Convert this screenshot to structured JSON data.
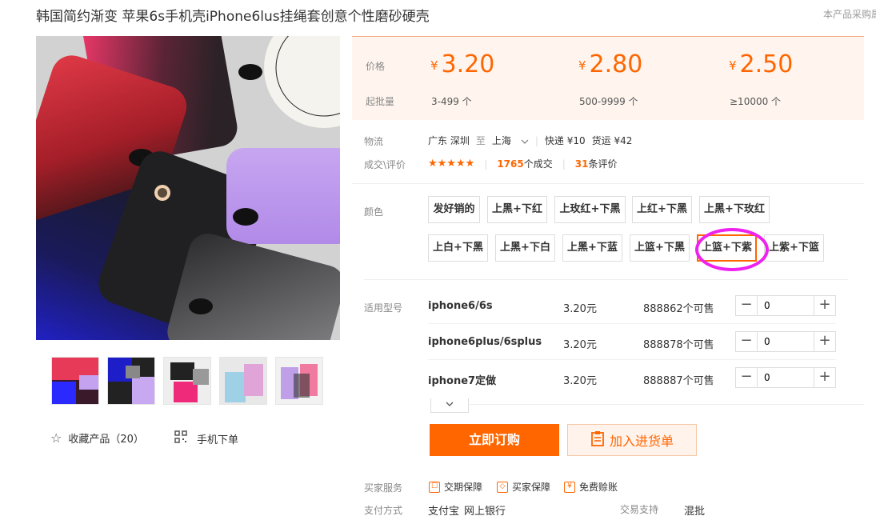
{
  "product": {
    "title": "韩国简约渐变 苹果6s手机壳iPhone6lus挂绳套创意个性磨砂硬壳",
    "notice": "本产品采购属"
  },
  "gallery": {
    "thumbnails": [
      "thumb-1",
      "thumb-2",
      "thumb-3",
      "thumb-4",
      "thumb-5"
    ],
    "favorite_label": "收藏产品（20）",
    "mobile_label": "手机下单"
  },
  "pricing": {
    "price_label": "价格",
    "min_qty_label": "起批量",
    "currency": "¥",
    "tiers": [
      {
        "price": "3.20",
        "qty": "3-499 个"
      },
      {
        "price": "2.80",
        "qty": "500-9999 个"
      },
      {
        "price": "2.50",
        "qty": "≥10000 个"
      }
    ]
  },
  "logistics": {
    "label": "物流",
    "from": "广东 深圳",
    "to_word": "至",
    "to": "上海",
    "express": "快递 ¥10",
    "freight": "货运 ¥42"
  },
  "deals": {
    "label": "成交\\评价",
    "stars": "★★★★★",
    "count": "1765",
    "count_suffix": "个成交",
    "reviews": "31",
    "reviews_suffix": "条评价"
  },
  "colors": {
    "label": "颜色",
    "options": [
      "发好销的",
      "上黑+下红",
      "上玫红+下黑",
      "上红+下黑",
      "上黑+下玫红",
      "上白+下黑",
      "上黑+下白",
      "上黑+下蓝",
      "上篮+下黑",
      "上篮+下紫",
      "上紫+下篮"
    ],
    "selected": "上篮+下紫"
  },
  "models": {
    "label": "适用型号",
    "rows": [
      {
        "name": "iphone6/6s",
        "price": "3.20元",
        "stock": "888862个可售",
        "qty": "0"
      },
      {
        "name": "iphone6plus/6splus",
        "price": "3.20元",
        "stock": "888878个可售",
        "qty": "0"
      },
      {
        "name": "iphone7定做",
        "price": "3.20元",
        "stock": "888887个可售",
        "qty": "0"
      }
    ],
    "minus": "−",
    "plus": "+"
  },
  "actions": {
    "order": "立即订购",
    "cart": "加入进货单"
  },
  "services": {
    "label": "买家服务",
    "items": [
      "交期保障",
      "买家保障",
      "免费赊账"
    ]
  },
  "payment": {
    "label": "支付方式",
    "methods": [
      "支付宝",
      "网上银行"
    ],
    "trade_label": "交易支持",
    "trade_value": "混批"
  },
  "theme": {
    "accent": "#ff6600",
    "highlight": "#ee22ee"
  }
}
